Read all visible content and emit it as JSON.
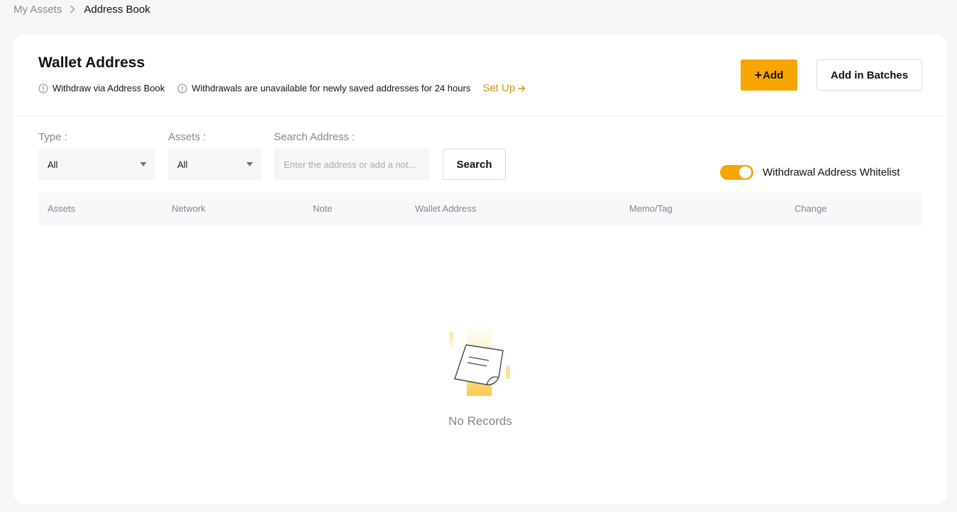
{
  "breadcrumb": {
    "parent": "My Assets",
    "current": "Address Book"
  },
  "header": {
    "title": "Wallet Address",
    "notes": [
      "Withdraw via Address Book",
      "Withdrawals are unavailable for newly saved addresses for 24 hours"
    ],
    "setup_link": "Set Up",
    "add_button": "Add",
    "batch_button": "Add in Batches"
  },
  "filters": {
    "type_label": "Type",
    "type_value": "All",
    "assets_label": "Assets",
    "assets_value": "All",
    "search_label": "Search Address",
    "search_placeholder": "Enter the address or add a not...",
    "search_button": "Search",
    "whitelist_label": "Withdrawal Address Whitelist",
    "whitelist_enabled": true
  },
  "table": {
    "columns": [
      "Assets",
      "Network",
      "Note",
      "Wallet Address",
      "Memo/Tag",
      "Change"
    ],
    "rows": []
  },
  "empty_state": {
    "text": "No Records"
  },
  "colors": {
    "accent": "#f7a600",
    "link": "#d8941a",
    "muted_text": "#81858c",
    "background": "#f6f6f6"
  }
}
